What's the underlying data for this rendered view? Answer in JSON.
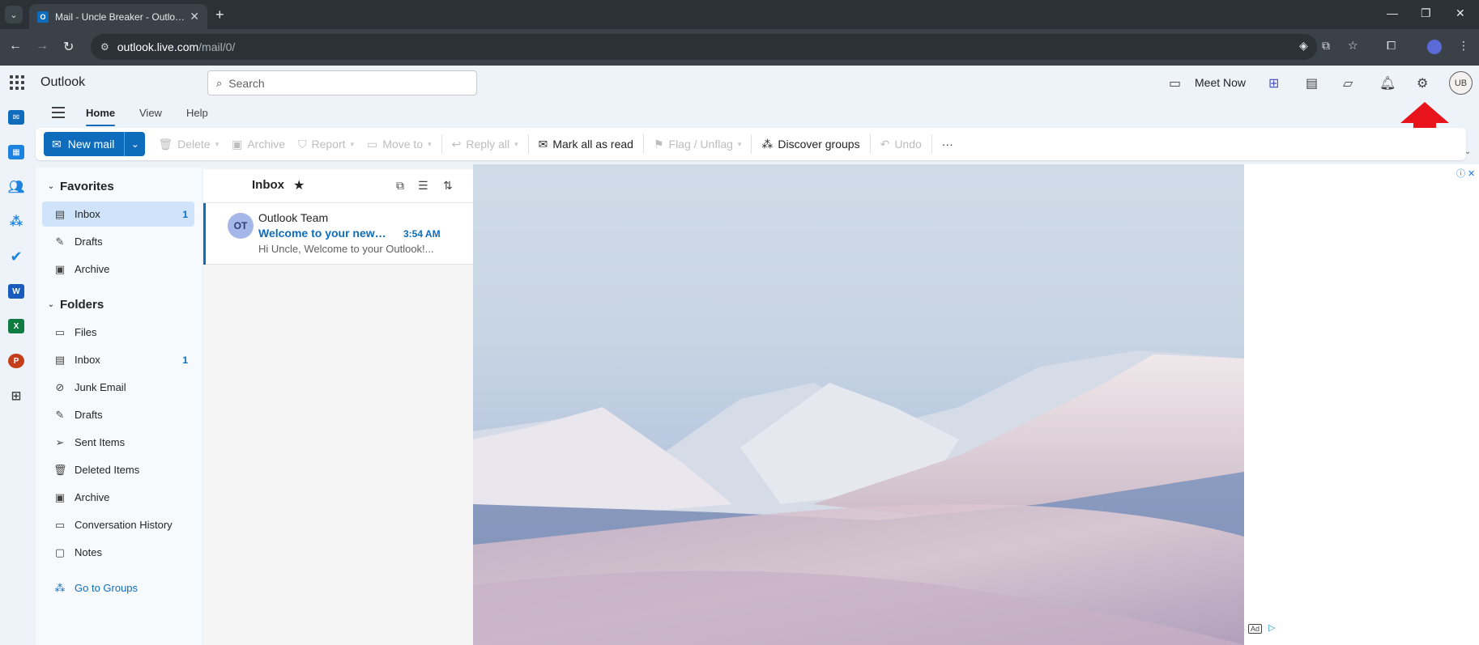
{
  "browser": {
    "tab_title": "Mail - Uncle Breaker - Outlook",
    "tab_favicon_text": "O",
    "url_host": "outlook.live.com",
    "url_path": "/mail/0/"
  },
  "app": {
    "name": "Outlook",
    "search_placeholder": "Search",
    "meet_now_label": "Meet Now",
    "avatar_initials": "UB"
  },
  "ribbon": {
    "tabs": [
      "Home",
      "View",
      "Help"
    ],
    "new_mail_label": "New mail",
    "buttons": {
      "delete": "Delete",
      "archive": "Archive",
      "report": "Report",
      "move_to": "Move to",
      "reply_all": "Reply all",
      "mark_all_read": "Mark all as read",
      "flag": "Flag / Unflag",
      "discover_groups": "Discover groups",
      "undo": "Undo",
      "more": "···"
    }
  },
  "folders": {
    "favorites_header": "Favorites",
    "favorites": [
      {
        "label": "Inbox",
        "count": "1"
      },
      {
        "label": "Drafts",
        "count": ""
      },
      {
        "label": "Archive",
        "count": ""
      }
    ],
    "folders_header": "Folders",
    "items": [
      {
        "label": "Files",
        "count": ""
      },
      {
        "label": "Inbox",
        "count": "1"
      },
      {
        "label": "Junk Email",
        "count": ""
      },
      {
        "label": "Drafts",
        "count": ""
      },
      {
        "label": "Sent Items",
        "count": ""
      },
      {
        "label": "Deleted Items",
        "count": ""
      },
      {
        "label": "Archive",
        "count": ""
      },
      {
        "label": "Conversation History",
        "count": ""
      },
      {
        "label": "Notes",
        "count": ""
      }
    ],
    "go_to_groups": "Go to Groups"
  },
  "message_list": {
    "title": "Inbox",
    "messages": [
      {
        "initials": "OT",
        "from": "Outlook Team",
        "subject": "Welcome to your new Outlook.com account",
        "time": "3:54 AM",
        "preview": "Hi Uncle, Welcome to your Outlook!..."
      }
    ]
  },
  "ad": {
    "badge": "Ad"
  },
  "colors": {
    "accent": "#0f6cbd",
    "selected_folder": "#cfe4fa",
    "annotation_arrow": "#e8141b"
  }
}
